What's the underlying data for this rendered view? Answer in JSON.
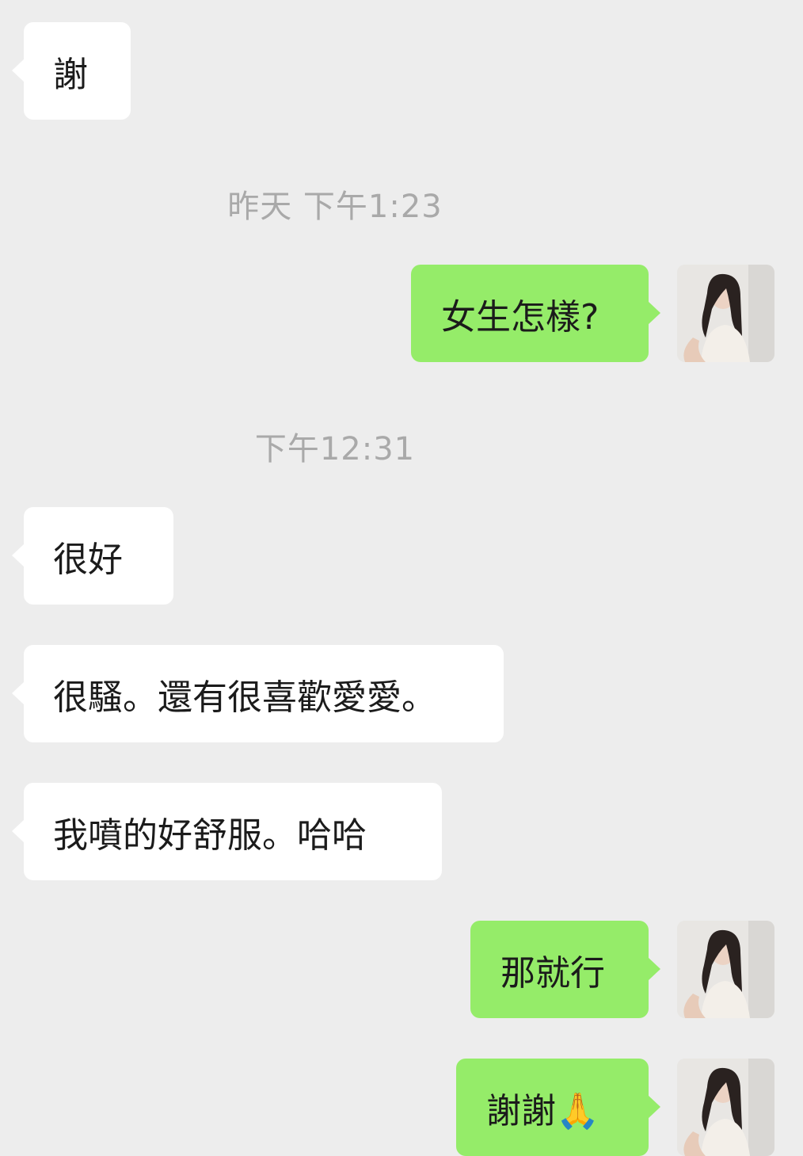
{
  "chat": {
    "messages": [
      {
        "type": "incoming",
        "text": "謝"
      },
      {
        "type": "timestamp",
        "text": "昨天 下午1:23"
      },
      {
        "type": "outgoing",
        "text": "女生怎樣?"
      },
      {
        "type": "timestamp",
        "text": "下午12:31"
      },
      {
        "type": "incoming",
        "text": "很好"
      },
      {
        "type": "incoming",
        "text": "很騷。還有很喜歡愛愛。"
      },
      {
        "type": "incoming",
        "text": "我噴的好舒服。哈哈"
      },
      {
        "type": "outgoing",
        "text": "那就行"
      },
      {
        "type": "outgoing",
        "text": "謝謝🙏"
      }
    ]
  },
  "colors": {
    "background": "#ededed",
    "incoming_bubble": "#ffffff",
    "outgoing_bubble": "#95ec69",
    "timestamp_text": "#a9a9a9"
  },
  "icons": {
    "avatar": "user-avatar-photo"
  }
}
